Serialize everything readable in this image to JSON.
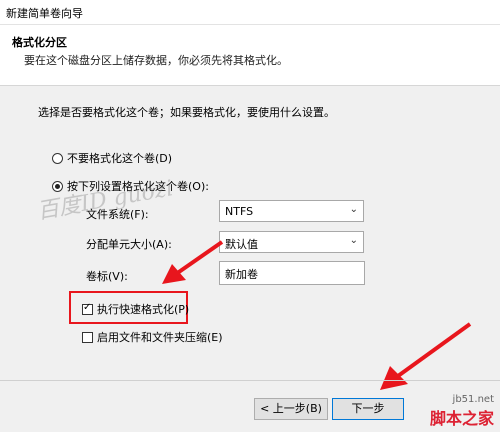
{
  "window": {
    "title": "新建简单卷向导"
  },
  "header": {
    "title": "格式化分区",
    "subtitle": "要在这个磁盘分区上储存数据，你必须先将其格式化。"
  },
  "intro": "选择是否要格式化这个卷；如果要格式化，要使用什么设置。",
  "options": {
    "no_format": "不要格式化这个卷(D)",
    "format_with": "按下列设置格式化这个卷(O):"
  },
  "fields": {
    "fs_label": "文件系统(F):",
    "fs_value": "NTFS",
    "alloc_label": "分配单元大小(A):",
    "alloc_value": "默认值",
    "vol_label": "卷标(V):",
    "vol_value": "新加卷"
  },
  "checks": {
    "quick": "执行快速格式化(P)",
    "compress": "启用文件和文件夹压缩(E)"
  },
  "buttons": {
    "back": "< 上一步(B)",
    "next": "下一步"
  },
  "watermark": "百度ID guozi",
  "site": {
    "url": "jb51.net",
    "name": "脚本之家"
  },
  "colors": {
    "highlight": "#e8161d",
    "arrow": "#e8161d"
  }
}
